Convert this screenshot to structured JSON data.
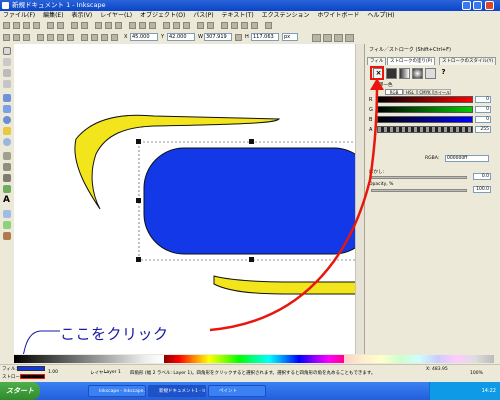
{
  "window": {
    "title": "新規ドキュメント 1 - Inkscape"
  },
  "menu": [
    "ファイル(F)",
    "編集(E)",
    "表示(V)",
    "レイヤー(L)",
    "オブジェクト(O)",
    "パス(P)",
    "テキスト(T)",
    "エクステンション",
    "ホワイトボード",
    "ヘルプ(H)"
  ],
  "toolbar2": {
    "x_label": "X",
    "x_value": "45.000",
    "y_label": "Y",
    "y_value": "42.000",
    "w_label": "W",
    "w_value": "307.919",
    "h_label": "H",
    "h_value": "117.063",
    "unit": "px"
  },
  "panel": {
    "title": "フィル／ストローク (Shift+Ctrl+F)",
    "tabs": [
      "フィル",
      "ストロークの塗り(P)",
      "ストロークのスタイル(Y)"
    ],
    "flat_color_label": "単一色",
    "mode_tab": "RGB",
    "mode_tab2": "HSL",
    "mode_tab3": "CMYK",
    "mode_tab4": "ホイール",
    "channels": [
      {
        "label": "R",
        "value": "0"
      },
      {
        "label": "G",
        "value": "0"
      },
      {
        "label": "B",
        "value": "0"
      },
      {
        "label": "A",
        "value": "255"
      }
    ],
    "rgba_label": "RGBA:",
    "rgba_value": "000000ff",
    "blur_label": "ぼかし:",
    "blur_value": "0.0",
    "opacity_label": "Opacity, %",
    "opacity_value": "100.0"
  },
  "status": {
    "fill_label": "フィル:",
    "stroke_label": "ストローク:",
    "stroke_width": "1.00",
    "layer_label": "レイヤー",
    "layer_value": "Layer 1",
    "message": "四角形 (幅 2 ラベル: Layer 1)。四角形をクリックすると選択されます。選択すると四角形の角を丸めることもできます。",
    "coords": "X: 483.95",
    "zoom": "100%"
  },
  "taskbar": {
    "start": "スタート",
    "tasks": [
      "Inkscape - Inkscape…",
      "新規ドキュメント1 - Ink…",
      "ペイント"
    ],
    "clock": "14:22"
  },
  "annotation": {
    "text": "ここをクリック"
  }
}
